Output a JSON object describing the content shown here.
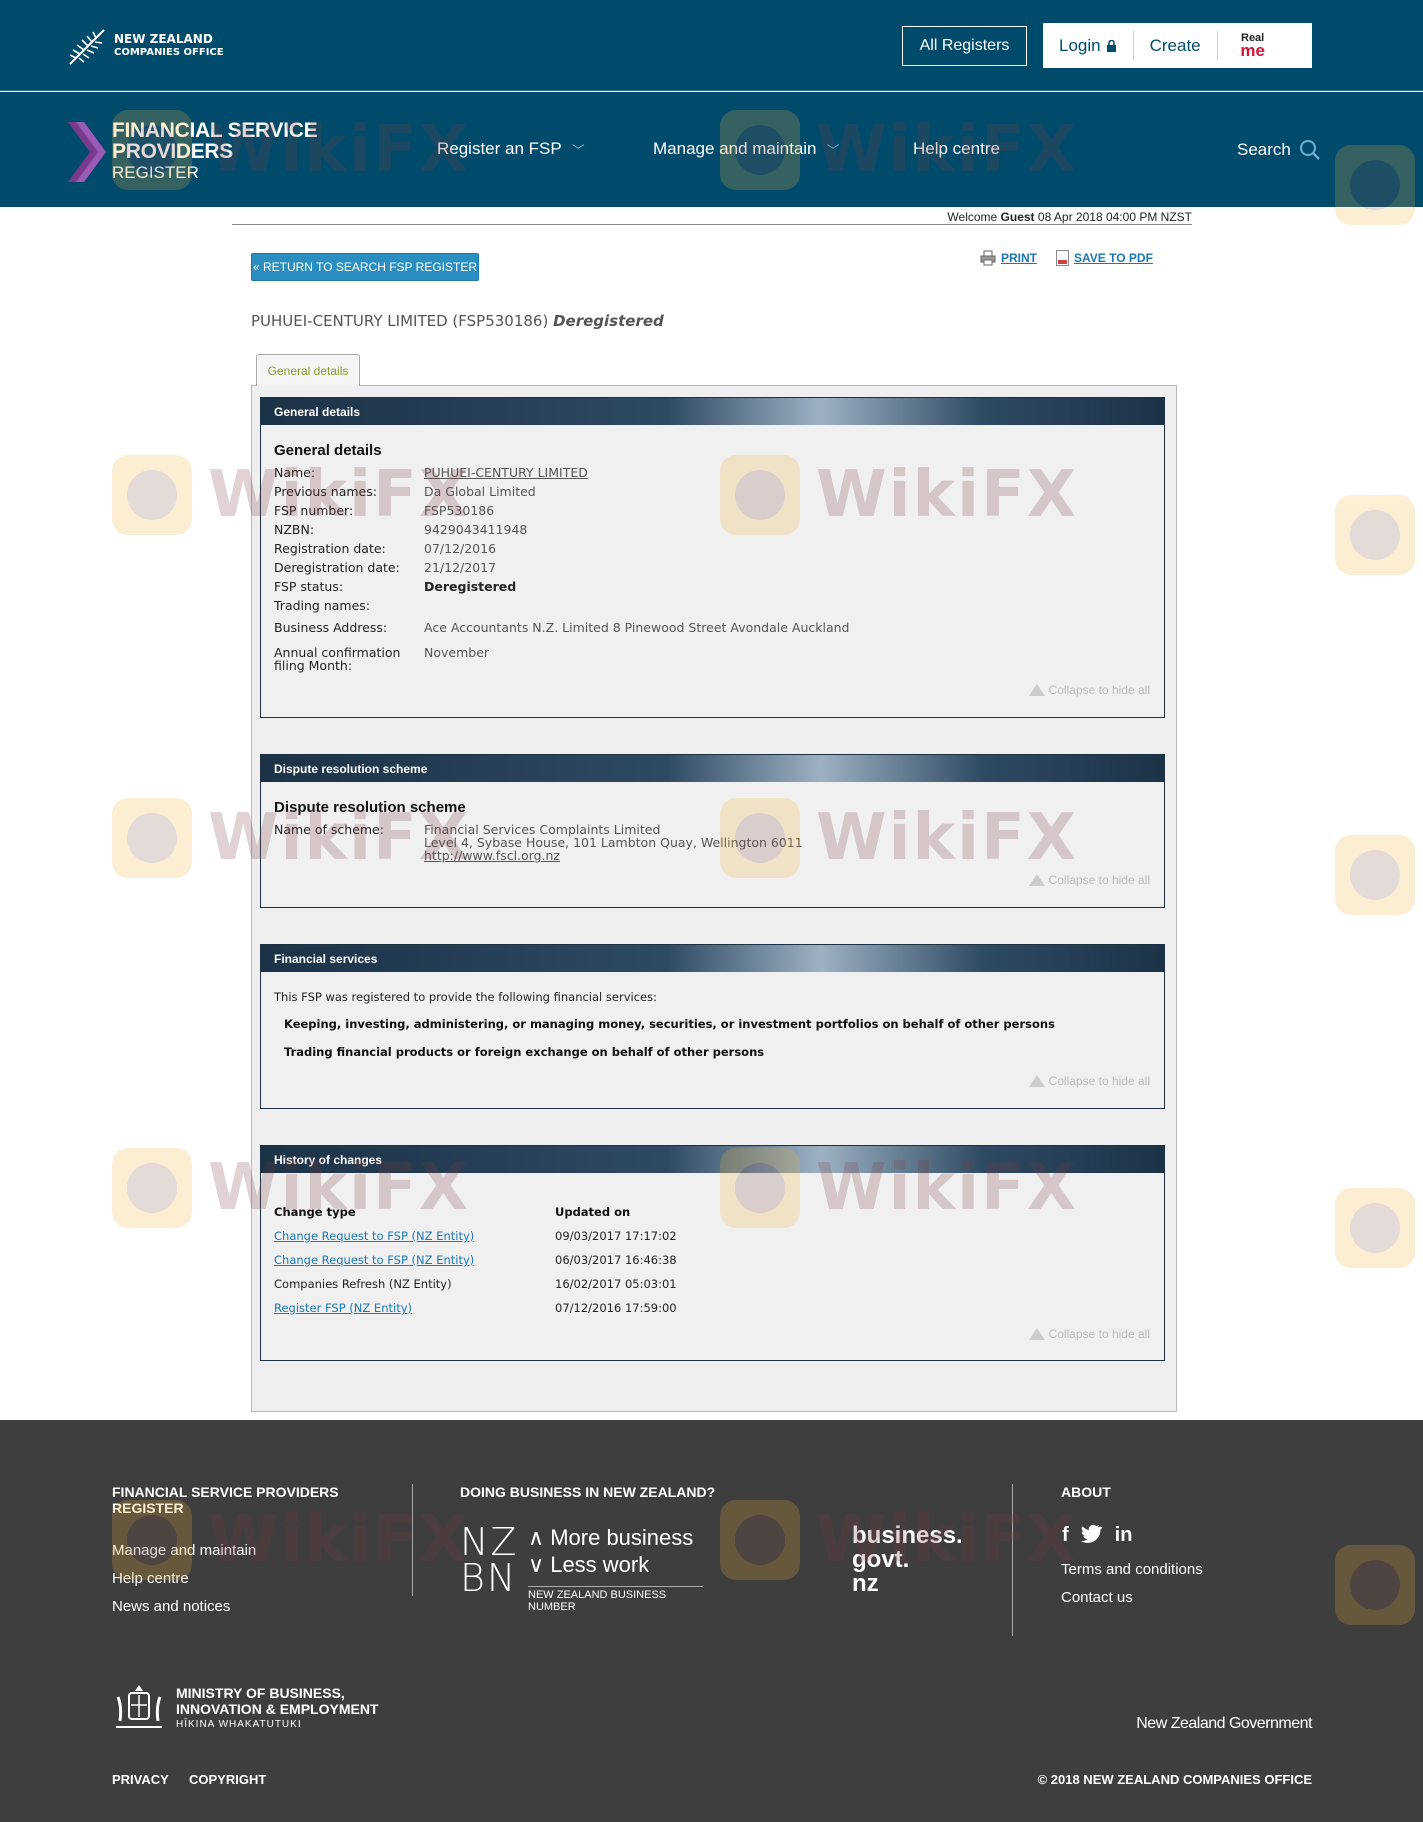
{
  "header": {
    "logo_line1": "NEW ZEALAND",
    "logo_line2": "COMPANIES OFFICE",
    "all_registers": "All Registers",
    "login": "Login",
    "create": "Create",
    "realme_top": "Real",
    "realme_bottom": "me"
  },
  "nav": {
    "title_line1": "FINANCIAL SERVICE",
    "title_line2": "PROVIDERS",
    "title_line3": "REGISTER",
    "items": [
      "Register an FSP",
      "Manage and maintain",
      "Help centre"
    ],
    "search": "Search"
  },
  "welcome": {
    "prefix": "Welcome",
    "user": "Guest",
    "datetime": "08 Apr 2018 04:00 PM NZST"
  },
  "actions": {
    "return_label": "« RETURN TO SEARCH FSP REGISTER",
    "print_label": "PRINT",
    "pdf_label": "SAVE TO PDF"
  },
  "entity": {
    "name_fsp": "PUHUEI-CENTURY LIMITED (FSP530186)",
    "status": "Deregistered"
  },
  "tab_label": "General details",
  "general": {
    "header": "General details",
    "subheading": "General details",
    "rows": [
      {
        "label": "Name:",
        "value": "PUHUEI-CENTURY LIMITED"
      },
      {
        "label": "Previous names:",
        "value": "Da Global Limited"
      },
      {
        "label": "FSP number:",
        "value": "FSP530186"
      },
      {
        "label": "NZBN:",
        "value": "9429043411948"
      },
      {
        "label": "Registration date:",
        "value": "07/12/2016"
      },
      {
        "label": "Deregistration date:",
        "value": "21/12/2017"
      },
      {
        "label": "FSP status:",
        "value": "Deregistered"
      },
      {
        "label": "Trading names:",
        "value": ""
      },
      {
        "label": "Business Address:",
        "value": "Ace Accountants N.Z. Limited 8 Pinewood Street Avondale Auckland"
      },
      {
        "label": "Annual confirmation filing Month:",
        "value": "November"
      }
    ],
    "collapse": "Collapse to hide all"
  },
  "dispute": {
    "header": "Dispute resolution scheme",
    "subheading": "Dispute resolution scheme",
    "label": "Name of scheme:",
    "name": "Financial Services Complaints Limited",
    "address": "Level 4, Sybase House, 101 Lambton Quay, Wellington 6011",
    "url": "http://www.fscl.org.nz",
    "collapse": "Collapse to hide all"
  },
  "services": {
    "header": "Financial services",
    "intro": "This FSP was registered to provide the following financial services:",
    "items": [
      "Keeping, investing, administering, or managing money, securities, or investment portfolios on behalf of other persons",
      "Trading financial products or foreign exchange on behalf of other persons"
    ],
    "collapse": "Collapse to hide all"
  },
  "history": {
    "header": "History of changes",
    "col_type": "Change type",
    "col_updated": "Updated on",
    "rows": [
      {
        "type": "Change Request to FSP (NZ Entity)",
        "updated": "09/03/2017 17:17:02",
        "link": true
      },
      {
        "type": "Change Request to FSP (NZ Entity)",
        "updated": "06/03/2017 16:46:38",
        "link": true
      },
      {
        "type": "Companies Refresh (NZ Entity)",
        "updated": "16/02/2017 05:03:01",
        "link": false
      },
      {
        "type": "Register FSP (NZ Entity)",
        "updated": "07/12/2016 17:59:00",
        "link": true
      }
    ],
    "collapse": "Collapse to hide all"
  },
  "footer": {
    "col1_heading": "FINANCIAL SERVICE PROVIDERS REGISTER",
    "col1_links": [
      "Manage and maintain",
      "Help centre",
      "News and notices"
    ],
    "col2_heading": "DOING BUSINESS IN NEW ZEALAND?",
    "nzbn_letters_top": "NZ",
    "nzbn_letters_bottom": "BN",
    "nzbn_tag1": "∧ More business",
    "nzbn_tag2": "∨ Less work",
    "nzbn_sub": "NEW ZEALAND BUSINESS NUMBER",
    "biz_line1": "business.",
    "biz_line2": "govt.",
    "biz_line3": "nz",
    "col3_heading": "ABOUT",
    "social": [
      "f",
      "t",
      "in"
    ],
    "col3_links": [
      "Terms and conditions",
      "Contact us"
    ],
    "mbie_line1": "MINISTRY OF BUSINESS,",
    "mbie_line2": "INNOVATION & EMPLOYMENT",
    "mbie_maori": "HĪKINA WHAKATUTUKI",
    "nzgov": "New Zealand Government",
    "privacy": "PRIVACY",
    "copyright": "COPYRIGHT",
    "copyright_notice": "© 2018 NEW ZEALAND COMPANIES OFFICE"
  },
  "watermark": "WikiFX",
  "colors": {
    "header_bg": "#004b6c",
    "footer_bg": "#3e3e3e",
    "link": "#1a78b4",
    "button": "#2a8fc0",
    "panel_head": "#1c3247"
  }
}
